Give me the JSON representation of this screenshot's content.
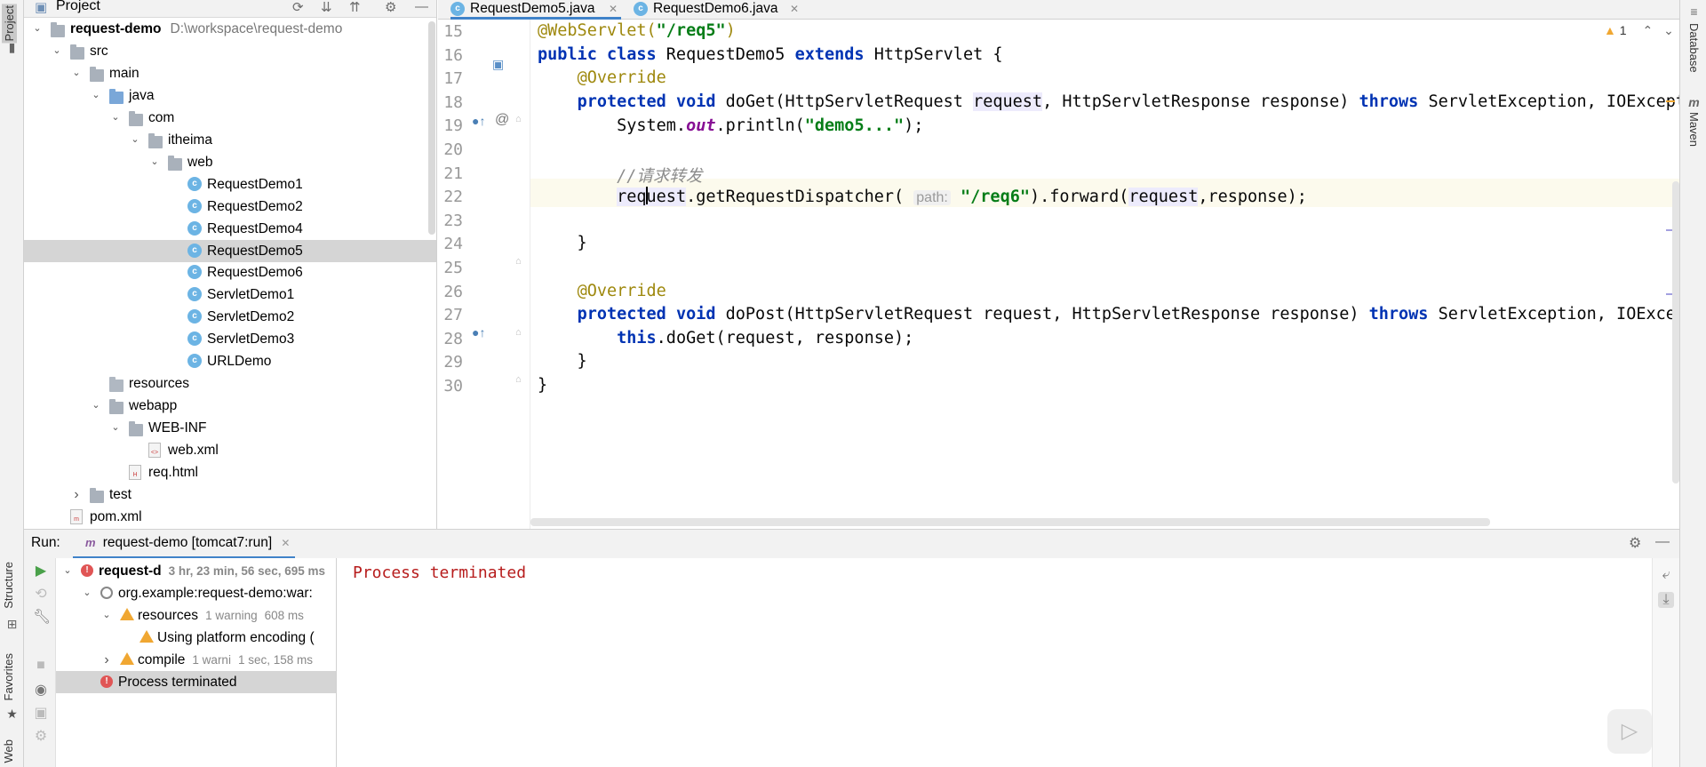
{
  "left_strip": {
    "project_label": "Project",
    "structure_label": "Structure",
    "favorites_label": "Favorites",
    "web_label": "Web"
  },
  "right_strip": {
    "database_label": "Database",
    "maven_label": "Maven"
  },
  "project_panel": {
    "title": "Project",
    "tree": [
      {
        "label": "request-demo",
        "path": "D:\\workspace\\request-demo",
        "bold": true,
        "indent": 0,
        "expanded": true,
        "icon": "folder-icon"
      },
      {
        "label": "src",
        "indent": 1,
        "expanded": true,
        "icon": "folder-icon"
      },
      {
        "label": "main",
        "indent": 2,
        "expanded": true,
        "icon": "folder-icon"
      },
      {
        "label": "java",
        "indent": 3,
        "expanded": true,
        "icon": "source-folder-icon"
      },
      {
        "label": "com",
        "indent": 4,
        "expanded": true,
        "icon": "package-icon"
      },
      {
        "label": "itheima",
        "indent": 5,
        "expanded": true,
        "icon": "package-icon"
      },
      {
        "label": "web",
        "indent": 6,
        "expanded": true,
        "icon": "package-icon"
      },
      {
        "label": "RequestDemo1",
        "indent": 7,
        "icon": "class-icon"
      },
      {
        "label": "RequestDemo2",
        "indent": 7,
        "icon": "class-icon"
      },
      {
        "label": "RequestDemo4",
        "indent": 7,
        "icon": "class-icon"
      },
      {
        "label": "RequestDemo5",
        "indent": 7,
        "icon": "class-icon",
        "selected": true
      },
      {
        "label": "RequestDemo6",
        "indent": 7,
        "icon": "class-icon"
      },
      {
        "label": "ServletDemo1",
        "indent": 7,
        "icon": "class-icon"
      },
      {
        "label": "ServletDemo2",
        "indent": 7,
        "icon": "class-icon"
      },
      {
        "label": "ServletDemo3",
        "indent": 7,
        "icon": "class-icon"
      },
      {
        "label": "URLDemo",
        "indent": 7,
        "icon": "class-icon"
      },
      {
        "label": "resources",
        "indent": 3,
        "icon": "resources-folder-icon"
      },
      {
        "label": "webapp",
        "indent": 3,
        "expanded": true,
        "icon": "web-folder-icon"
      },
      {
        "label": "WEB-INF",
        "indent": 4,
        "expanded": true,
        "icon": "folder-icon"
      },
      {
        "label": "web.xml",
        "indent": 5,
        "icon": "xml-file-icon"
      },
      {
        "label": "req.html",
        "indent": 4,
        "icon": "html-file-icon"
      },
      {
        "label": "test",
        "indent": 2,
        "expanded": false,
        "icon": "folder-icon"
      },
      {
        "label": "pom.xml",
        "indent": 1,
        "icon": "maven-file-icon"
      }
    ]
  },
  "editor": {
    "tabs": [
      {
        "label": "RequestDemo5.java",
        "active": true
      },
      {
        "label": "RequestDemo6.java",
        "active": false
      }
    ],
    "warning_count": "1",
    "line_numbers": [
      "15",
      "16",
      "17",
      "18",
      "19",
      "20",
      "21",
      "22",
      "23",
      "24",
      "25",
      "26",
      "27",
      "28",
      "29",
      "30"
    ],
    "hint_path": "path:"
  },
  "run_panel": {
    "label": "Run:",
    "config": "request-demo [tomcat7:run]",
    "tree": [
      {
        "label": "request-d",
        "meta": "3 hr, 23 min, 56 sec, 695 ms",
        "indent": 0,
        "icon": "error-icon",
        "bold": true
      },
      {
        "label": "org.example:request-demo:war:",
        "meta": "",
        "indent": 1,
        "icon": "skipped-icon"
      },
      {
        "label": "resources",
        "meta": "1 warning",
        "meta2": "608 ms",
        "indent": 2,
        "icon": "warning-icon"
      },
      {
        "label": "Using platform encoding (",
        "meta": "",
        "indent": 3,
        "icon": "warning-icon"
      },
      {
        "label": "compile",
        "meta": "1 warni",
        "meta2": "1 sec, 158 ms",
        "indent": 2,
        "icon": "warning-icon",
        "collapsed": true
      },
      {
        "label": "Process terminated",
        "meta": "",
        "indent": 1,
        "icon": "error-icon",
        "selected": true
      }
    ],
    "console_text": "Process terminated"
  }
}
